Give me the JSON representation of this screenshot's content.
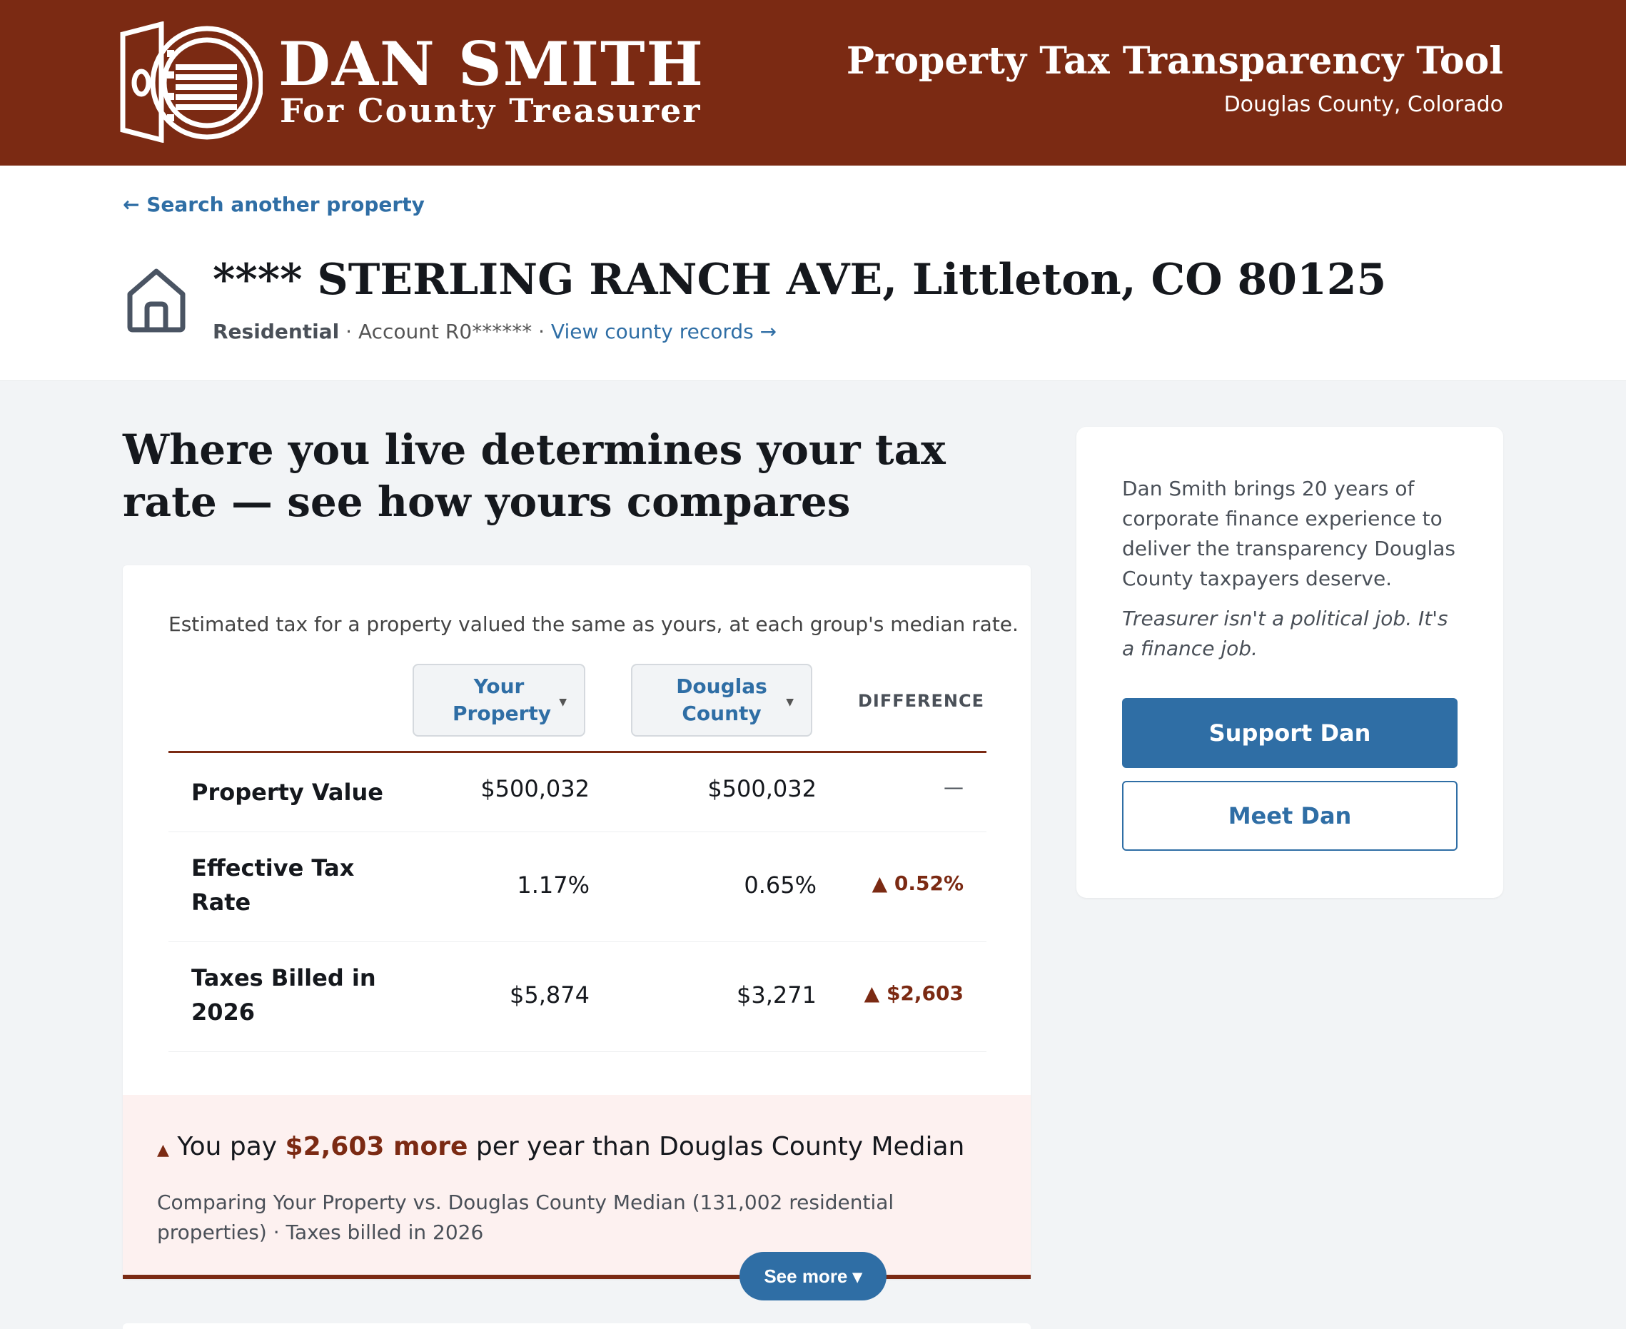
{
  "header": {
    "brand_name": "DAN SMITH",
    "brand_sub": "For County Treasurer",
    "tool_title": "Property Tax Transparency Tool",
    "tool_sub": "Douglas County, Colorado"
  },
  "property": {
    "back_link": "← Search another property",
    "address": "**** STERLING RANCH AVE, Littleton, CO 80125",
    "type": "Residential",
    "separator": " · ",
    "account": "Account R0******",
    "county_link": "View county records →"
  },
  "main": {
    "heading": "Where you live determines your tax rate — see how yours compares"
  },
  "comparison": {
    "intro": "Estimated tax for a property valued the same as yours, at each group's median rate.",
    "col_yours": "Your Property",
    "col_county": "Douglas County",
    "col_diff": "DIFFERENCE",
    "rows": [
      {
        "label": "Property Value",
        "yours": "$500,032",
        "county": "$500,032",
        "diff": "—"
      },
      {
        "label": "Effective Tax Rate",
        "yours": "1.17%",
        "county": "0.65%",
        "diff": "▲ 0.52%"
      },
      {
        "label": "Taxes Billed in 2026",
        "yours": "$5,874",
        "county": "$3,271",
        "diff": "▲ $2,603"
      }
    ]
  },
  "summary": {
    "triangle": "▲",
    "prefix": " You pay ",
    "amount": "$2,603 more",
    "suffix": " per year than Douglas County Median",
    "description": "Comparing Your Property vs. Douglas County Median (131,002 residential properties) · Taxes billed in 2026",
    "see_more": "See more ▾"
  },
  "sidebar": {
    "body": "Dan Smith brings 20 years of corporate finance experience to deliver the transparency Douglas County taxpayers deserve.",
    "quote": "Treasurer isn't a political job. It's a finance job.",
    "support_label": "Support Dan",
    "meet_label": "Meet Dan"
  },
  "colors": {
    "brand": "#7b2a13",
    "accent": "#2f6ea5",
    "page_bg": "#f2f4f6",
    "summary_bg": "#fdf1f0"
  },
  "icons": {
    "logo": "vault-door-icon",
    "house": "house-icon",
    "caret": "caret-down-icon"
  }
}
